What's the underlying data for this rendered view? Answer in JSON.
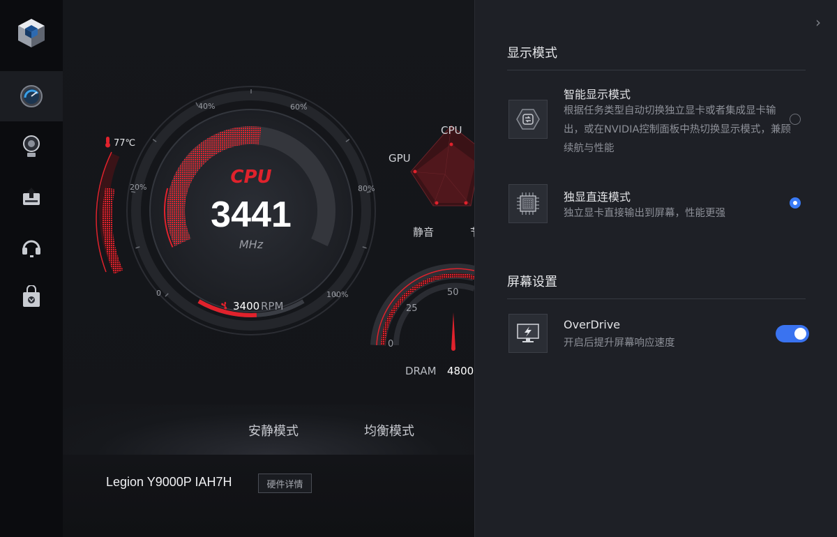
{
  "sidebar": {
    "logo_icon": "cube-logo-icon",
    "items": [
      {
        "icon": "gauge-icon",
        "active": true
      },
      {
        "icon": "lightbulb-icon",
        "active": false
      },
      {
        "icon": "upload-box-icon",
        "active": false
      },
      {
        "icon": "headset-icon",
        "active": false
      },
      {
        "icon": "shopping-bag-icon",
        "active": false
      }
    ]
  },
  "cpu_gauge": {
    "label": "CPU",
    "value": "3441",
    "unit": "MHz",
    "load_fraction": 0.53,
    "tick_labels": [
      "0",
      "20%",
      "40%",
      "60%",
      "80%",
      "100%"
    ],
    "temperature": "77℃",
    "fan_value": "3400",
    "fan_unit": "RPM"
  },
  "radar": {
    "labels": [
      "CPU",
      "GPU",
      "静音",
      "节"
    ]
  },
  "dram_gauge": {
    "tick_labels": [
      "0",
      "25",
      "50"
    ],
    "label": "DRAM",
    "value": "4800"
  },
  "modes": {
    "quiet": "安静模式",
    "balanced": "均衡模式"
  },
  "device": {
    "name": "Legion Y9000P IAH7H",
    "details_button": "硬件详情"
  },
  "panel": {
    "collapse_icon": "chevron-right-icon",
    "display_section": {
      "title": "显示模式",
      "options": [
        {
          "icon": "smart-switch-icon",
          "title": "智能显示模式",
          "description": "根据任务类型自动切换独立显卡或者集成显卡输出，或在NVIDIA控制面板中热切换显示模式，兼顾续航与性能",
          "selected": false
        },
        {
          "icon": "chip-icon",
          "title": "独显直连模式",
          "description": "独立显卡直接输出到屏幕，性能更强",
          "selected": true
        }
      ]
    },
    "screen_section": {
      "title": "屏幕设置",
      "overdrive": {
        "icon": "monitor-bolt-icon",
        "title": "OverDrive",
        "description": "开启后提升屏幕响应速度",
        "enabled": true
      }
    }
  },
  "colors": {
    "accent_red": "#e0222c",
    "accent_blue": "#3a7bf7",
    "panel_bg": "#1e2026",
    "main_bg": "#15171b"
  }
}
